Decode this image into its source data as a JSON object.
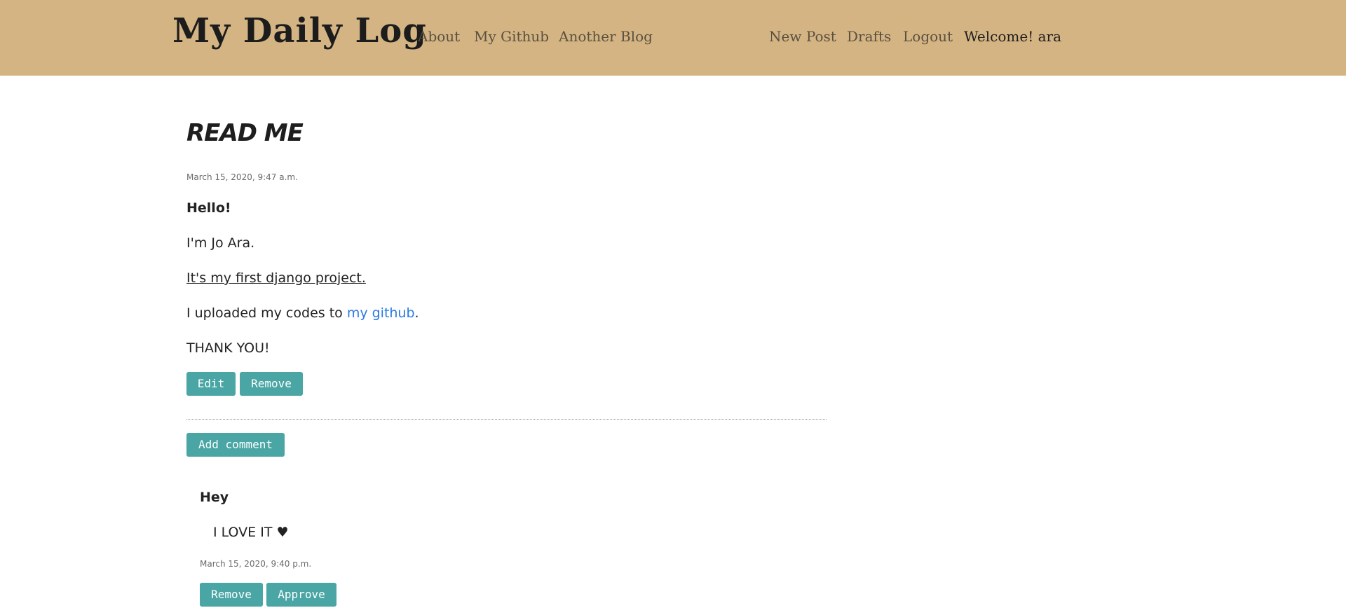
{
  "header": {
    "brand": "My Daily Log",
    "nav_left": [
      "About",
      "My Github",
      "Another Blog"
    ],
    "nav_right": [
      "New Post",
      "Drafts",
      "Logout"
    ],
    "welcome": "Welcome! ara",
    "background_color": "#d4b483"
  },
  "post": {
    "title": "READ ME",
    "date": "March 15, 2020, 9:47 a.m.",
    "greeting": "Hello!",
    "line_intro": "I'm Jo Ara.",
    "line_first_project": "It's my first django project.",
    "line_upload_prefix": "I uploaded my codes to ",
    "github_link": "my github",
    "line_upload_suffix": ".",
    "line_thanks": "THANK YOU!",
    "edit_label": "Edit",
    "remove_label": "Remove"
  },
  "comments_section": {
    "add_comment_label": "Add comment",
    "comments": [
      {
        "author": "Hey",
        "text": "I LOVE IT ♥",
        "date": "March 15, 2020, 9:40 p.m.",
        "remove_label": "Remove",
        "approve_label": "Approve"
      }
    ]
  },
  "colors": {
    "button": "#4aa5a5",
    "link": "#2a7ae2"
  }
}
